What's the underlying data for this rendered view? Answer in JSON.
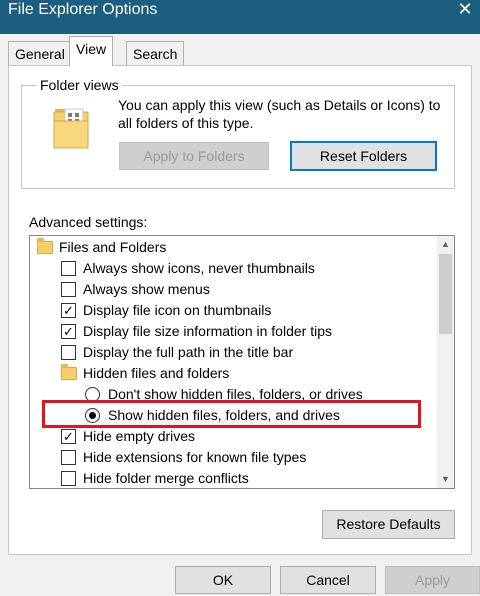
{
  "window": {
    "title": "File Explorer Options",
    "close_glyph": "✕"
  },
  "tabs": [
    {
      "label": "General"
    },
    {
      "label": "View"
    },
    {
      "label": "Search"
    }
  ],
  "folder_views": {
    "legend": "Folder views",
    "description": "You can apply this view (such as Details or Icons) to all folders of this type.",
    "apply_label": "Apply to Folders",
    "reset_label": "Reset Folders"
  },
  "advanced": {
    "label": "Advanced settings:",
    "items": [
      {
        "type": "folder",
        "label": "Files and Folders"
      },
      {
        "type": "checkbox",
        "checked": false,
        "label": "Always show icons, never thumbnails"
      },
      {
        "type": "checkbox",
        "checked": false,
        "label": "Always show menus"
      },
      {
        "type": "checkbox",
        "checked": true,
        "label": "Display file icon on thumbnails"
      },
      {
        "type": "checkbox",
        "checked": true,
        "label": "Display file size information in folder tips"
      },
      {
        "type": "checkbox",
        "checked": false,
        "label": "Display the full path in the title bar"
      },
      {
        "type": "folder",
        "label": "Hidden files and folders"
      },
      {
        "type": "radio",
        "checked": false,
        "label": "Don't show hidden files, folders, or drives"
      },
      {
        "type": "radio",
        "checked": true,
        "label": "Show hidden files, folders, and drives"
      },
      {
        "type": "checkbox",
        "checked": true,
        "label": "Hide empty drives"
      },
      {
        "type": "checkbox",
        "checked": false,
        "label": "Hide extensions for known file types"
      },
      {
        "type": "checkbox",
        "checked": false,
        "label": "Hide folder merge conflicts"
      }
    ],
    "check_glyph": "✓",
    "scroll_up_glyph": "▲",
    "scroll_down_glyph": "▼"
  },
  "buttons": {
    "restore": "Restore Defaults",
    "ok": "OK",
    "cancel": "Cancel",
    "apply": "Apply"
  },
  "colors": {
    "titlebar": "#1b5e7f",
    "highlight": "#e0141e",
    "focus_border": "#0078d7"
  },
  "icons": {
    "folder_views": "folder-with-icons-icon",
    "tree_folder": "folder-icon",
    "close": "close-icon"
  }
}
